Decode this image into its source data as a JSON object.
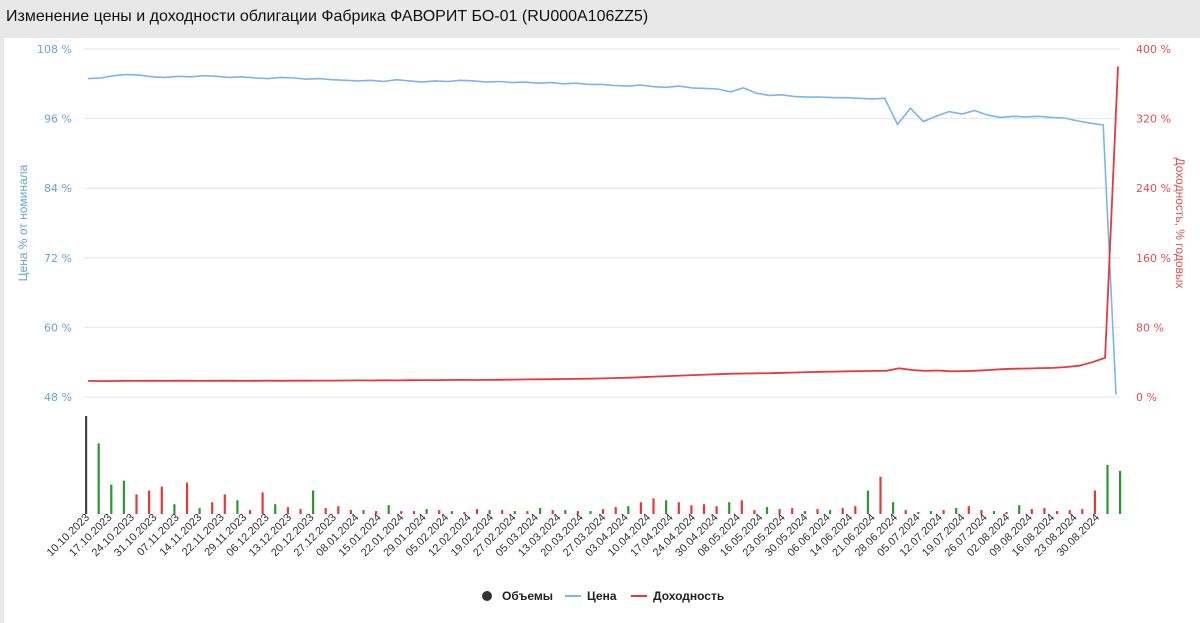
{
  "header": {
    "title": "Изменение цены и доходности облигации Фабрика ФАВОРИТ БО-01 (RU000A106ZZ5)"
  },
  "colors": {
    "price": "#7cb5ec",
    "yield": "#e8383d",
    "volume_up": "#2a9a2a",
    "volume_down": "#e53935",
    "volume_first": "#444444",
    "grid": "#e6e6e6"
  },
  "chart_data": {
    "type": "line",
    "title": "Изменение цены и доходности облигации Фабрика ФАВОРИТ БО-01 (RU000A106ZZ5)",
    "y_left": {
      "label": "Цена % от номинала",
      "ticks": [
        "48 %",
        "60 %",
        "72 %",
        "84 %",
        "96 %",
        "108 %"
      ],
      "range": [
        48,
        108
      ]
    },
    "y_right": {
      "label": "Доходность, % годовых",
      "ticks": [
        "0 %",
        "80 %",
        "160 %",
        "240 %",
        "320 %",
        "400 %"
      ],
      "range": [
        0,
        400
      ]
    },
    "x_dates": [
      "10.10.2023",
      "17.10.2023",
      "24.10.2023",
      "31.10.2023",
      "07.11.2023",
      "14.11.2023",
      "22.11.2023",
      "29.11.2023",
      "06.12.2023",
      "13.12.2023",
      "20.12.2023",
      "27.12.2023",
      "08.01.2024",
      "15.01.2024",
      "22.01.2024",
      "29.01.2024",
      "05.02.2024",
      "12.02.2024",
      "19.02.2024",
      "27.02.2024",
      "05.03.2024",
      "13.03.2024",
      "20.03.2024",
      "27.03.2024",
      "03.04.2024",
      "10.04.2024",
      "17.04.2024",
      "24.04.2024",
      "30.04.2024",
      "08.05.2024",
      "16.05.2024",
      "23.05.2024",
      "30.05.2024",
      "06.06.2024",
      "14.06.2024",
      "21.06.2024",
      "28.06.2024",
      "05.07.2024",
      "12.07.2024",
      "19.07.2024",
      "26.07.2024",
      "02.08.2024",
      "09.08.2024",
      "16.08.2024",
      "23.08.2024",
      "30.08.2024"
    ],
    "legend": [
      {
        "name": "Объемы",
        "color": "#333333",
        "symbol": "circle"
      },
      {
        "name": "Цена",
        "color": "#7cb5ec",
        "symbol": "line"
      },
      {
        "name": "Доходность",
        "color": "#e8383d",
        "symbol": "line"
      }
    ],
    "series": [
      {
        "name": "Цена",
        "axis": "left",
        "values": [
          102.9,
          103.0,
          103.4,
          103.6,
          103.5,
          103.2,
          103.1,
          103.3,
          103.2,
          103.4,
          103.3,
          103.1,
          103.2,
          103.0,
          102.9,
          103.1,
          103.0,
          102.8,
          102.9,
          102.7,
          102.6,
          102.5,
          102.6,
          102.4,
          102.7,
          102.5,
          102.3,
          102.5,
          102.4,
          102.6,
          102.5,
          102.3,
          102.4,
          102.2,
          102.3,
          102.1,
          102.2,
          102.0,
          102.1,
          101.9,
          101.9,
          101.7,
          101.6,
          101.8,
          101.5,
          101.4,
          101.6,
          101.3,
          101.2,
          101.1,
          100.6,
          101.3,
          100.4,
          100.0,
          100.1,
          99.8,
          99.7,
          99.7,
          99.6,
          99.6,
          99.5,
          99.4,
          99.5,
          95.0,
          97.8,
          95.5,
          96.4,
          97.2,
          96.8,
          97.4,
          96.6,
          96.2,
          96.4,
          96.3,
          96.4,
          96.2,
          96.1,
          95.6,
          95.2,
          94.9,
          48.4
        ],
        "_values_note": null
      },
      {
        "name": "Доходность",
        "axis": "right",
        "values": [
          18.5,
          18.3,
          18.4,
          18.6,
          18.5,
          18.6,
          18.5,
          18.7,
          18.6,
          18.5,
          18.6,
          18.7,
          18.5,
          18.6,
          18.7,
          18.6,
          18.8,
          18.7,
          18.9,
          18.8,
          19.0,
          19.1,
          19.0,
          19.2,
          19.1,
          19.3,
          19.4,
          19.3,
          19.5,
          19.6,
          19.5,
          19.7,
          19.8,
          20.0,
          20.2,
          20.4,
          20.5,
          20.7,
          20.9,
          21.0,
          21.4,
          21.8,
          22.2,
          22.8,
          23.4,
          24.0,
          24.6,
          25.2,
          25.8,
          26.2,
          26.8,
          27.0,
          27.2,
          27.4,
          27.8,
          28.2,
          28.6,
          29.0,
          29.2,
          29.5,
          29.8,
          30.0,
          30.1,
          33.0,
          31.0,
          30.0,
          30.5,
          29.5,
          29.8,
          30.2,
          31.0,
          32.0,
          32.5,
          32.8,
          33.2,
          33.5,
          34.5,
          36.0,
          40.0,
          45.0,
          380.0
        ]
      },
      {
        "name": "Объемы",
        "axis": "volume",
        "values": [
          100,
          72,
          30,
          34,
          20,
          24,
          28,
          10,
          32,
          6,
          12,
          20,
          14,
          4,
          22,
          10,
          7,
          5,
          24,
          6,
          8,
          4,
          4,
          3,
          9,
          3,
          3,
          5,
          4,
          3,
          2,
          5,
          4,
          4,
          3,
          3,
          6,
          4,
          4,
          3,
          3,
          5,
          7,
          8,
          12,
          16,
          14,
          12,
          9,
          10,
          8,
          12,
          14,
          4,
          7,
          5,
          6,
          3,
          5,
          4,
          6,
          8,
          24,
          38,
          12,
          4,
          2,
          3,
          4,
          6,
          8,
          4,
          3,
          2,
          9,
          5,
          6,
          3,
          4,
          5,
          24,
          50,
          44
        ]
      }
    ],
    "grid": true,
    "legend_position": "bottom-center"
  }
}
